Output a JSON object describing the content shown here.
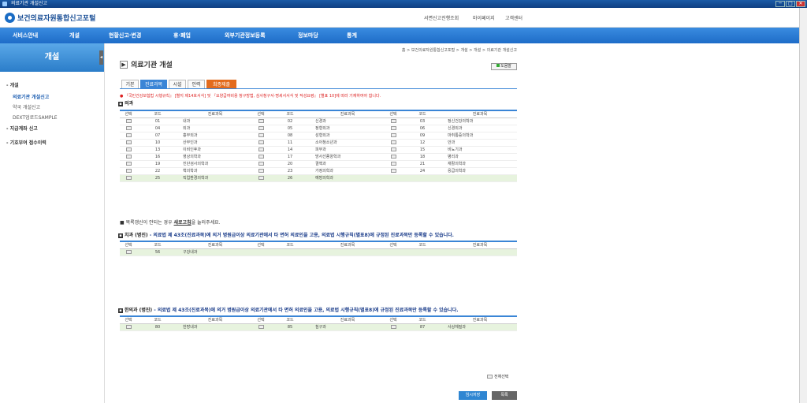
{
  "window": {
    "title": "의료기관 개설신고",
    "min": "─",
    "max": "□",
    "close": "✕"
  },
  "header": {
    "logo_text": "보건의료자원통합신고포털",
    "links": [
      "서면신고진행조회",
      "마이페이지",
      "고객센터"
    ]
  },
  "nav": [
    "서비스안내",
    "개설",
    "현황신고·변경",
    "휴·폐업",
    "외부기관정보등록",
    "정보마당",
    "통계"
  ],
  "sidebar": {
    "banner": "개설",
    "collapse": "◂",
    "menu": [
      {
        "label": "- 개설",
        "sub": [
          "의료기관 개설신고",
          "약국 개설신고",
          "DEXT업로드SAMPLE"
        ]
      },
      {
        "label": "- 지급계좌 신고"
      },
      {
        "label": "- 기호부여 접수이력"
      }
    ]
  },
  "breadcrumb": "홈 > 보건의료자원통합신고포털 > 개설 > 개설 > 의료기관 개설신고",
  "page_title": "의료기관 개설",
  "page_icon": "▶",
  "help": "도움말",
  "tabs": [
    "기본",
    "진료과목",
    "시설",
    "인력",
    "최종제출"
  ],
  "section1": {
    "title": "의과",
    "notice": "● 『국민건강보험법 시행규칙』 [별지 제14호서식] 및 『요양급여비용 청구방법, 심사청구서·명세서서식 및 작성요령』 [별표 10]에 따라 기재하여야 합니다.",
    "headers": [
      "선택",
      "코드",
      "진료과목",
      "선택",
      "코드",
      "진료과목",
      "선택",
      "코드",
      "진료과목"
    ],
    "rows": [
      [
        "01",
        "내과",
        "02",
        "신경과",
        "03",
        "정신건강의학과"
      ],
      [
        "04",
        "외과",
        "05",
        "정형외과",
        "06",
        "신경외과"
      ],
      [
        "07",
        "흉부외과",
        "08",
        "성형외과",
        "09",
        "마취통증의학과"
      ],
      [
        "10",
        "산부인과",
        "11",
        "소아청소년과",
        "12",
        "안과"
      ],
      [
        "13",
        "이비인후과",
        "14",
        "피부과",
        "15",
        "비뇨기과"
      ],
      [
        "16",
        "영상의학과",
        "17",
        "방사선종양학과",
        "18",
        "병리과"
      ],
      [
        "19",
        "진단검사의학과",
        "20",
        "결핵과",
        "21",
        "재활의학과"
      ],
      [
        "22",
        "핵의학과",
        "23",
        "가정의학과",
        "24",
        "응급의학과"
      ],
      [
        "25",
        "직업환경의학과",
        "26",
        "예방의학과",
        "",
        ""
      ]
    ]
  },
  "refresh_note": {
    "pre": "목록갱신이 안되는 경우 ",
    "bold": "새로고침",
    "post": "을 눌러주세요."
  },
  "section2": {
    "title": "치과 (병진)",
    "note": "- 의료법 제 43조(진료과목)에 의거 병원급이상 의료기관에서 타 면허 의료인을 고용, 의료법 시행규칙(별표8)에 규정된 진료과목만 등록할 수 있습니다.",
    "headers": [
      "선택",
      "코드",
      "진료과목",
      "선택",
      "코드",
      "진료과목",
      "선택",
      "코드",
      "진료과목"
    ],
    "rows": [
      [
        "56",
        "구강내과",
        "",
        "",
        "",
        ""
      ]
    ]
  },
  "section3": {
    "title": "한의과 (병진)",
    "note": "- 의료법 제 43조(진료과목)에 의거 병원급이상 의료기관에서 타 면허 의료인을 고용, 의료법 시행규칙(별표8)에 규정된 진료과목만 등록할 수 있습니다.",
    "headers": [
      "선택",
      "코드",
      "진료과목",
      "선택",
      "코드",
      "진료과목",
      "선택",
      "코드",
      "진료과목"
    ],
    "rows": [
      [
        "80",
        "한방내과",
        "85",
        "침구과",
        "87",
        "사상체질과"
      ]
    ]
  },
  "select_all": "전체선택",
  "save_btn": "임시저장",
  "list_btn": "목록",
  "colors": {
    "nav": "#1e6cc8",
    "accent": "#3a85d6",
    "final_tab": "#e36b1d",
    "green_row": "#e7f3de"
  }
}
